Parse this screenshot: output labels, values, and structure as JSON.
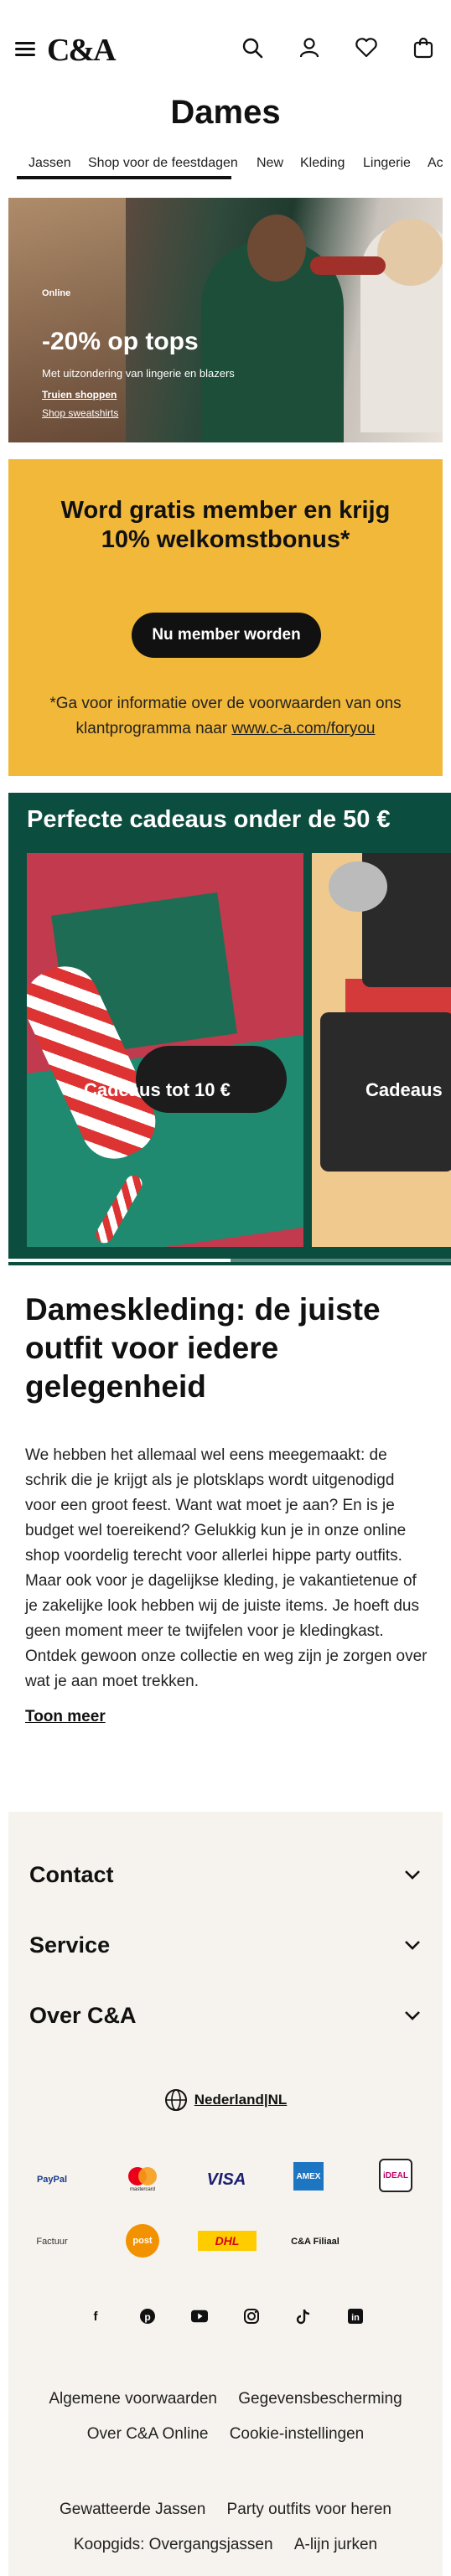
{
  "header": {
    "logo": "C&A",
    "page_title": "Dames"
  },
  "tabs": [
    "Jassen",
    "Shop voor de feestdagen",
    "New",
    "Kleding",
    "Lingerie",
    "Ac"
  ],
  "hero": {
    "eyebrow": "Online",
    "headline": "-20% op tops",
    "subline": "Met uitzondering van lingerie en blazers",
    "link_primary": "Truien shoppen",
    "link_secondary": "Shop sweatshirts"
  },
  "member": {
    "title": "Word gratis member en krijg 10% welkomstbonus*",
    "button": "Nu member worden",
    "note_prefix": "*Ga voor informatie over de voorwaarden van ons klantprogramma naar ",
    "note_link": "www.c-a.com/foryou"
  },
  "gifts": {
    "title": "Perfecte cadeaus onder de 50 €",
    "cards": [
      {
        "label": "Cadeaus tot 10 €"
      },
      {
        "label": "Cadeaus"
      }
    ]
  },
  "seo": {
    "title": "Dameskleding: de juiste outfit voor iedere gelegenheid",
    "body": "We hebben het allemaal wel eens meegemaakt: de schrik die je krijgt als je plotsklaps wordt uitgenodigd voor een groot feest. Want wat moet je aan? En is je budget wel toereikend? Gelukkig kun je in onze online shop voordelig terecht voor allerlei hippe party outfits. Maar ook voor je dagelijkse kleding, je vakantietenue of je zakelijke look hebben wij de juiste items. Je hoeft dus geen moment meer te twijfelen voor je kledingkast. Ontdek gewoon onze collectie en weg zijn je zorgen over wat je aan moet trekken.",
    "more": "Toon meer"
  },
  "footer": {
    "accordions": [
      "Contact",
      "Service",
      "Over C&A"
    ],
    "language": "Nederland|NL",
    "payments_row1": [
      "PayPal",
      "mastercard",
      "VISA",
      "AMEX",
      "iDEAL"
    ],
    "payments_row2": [
      "Factuur",
      "post",
      "DHL",
      "C&A Filiaal"
    ],
    "social": [
      "facebook-icon",
      "pinterest-icon",
      "youtube-icon",
      "instagram-icon",
      "tiktok-icon",
      "linkedin-icon"
    ],
    "links_row1": [
      "Algemene voorwaarden",
      "Gegevensbescherming"
    ],
    "links_row2": [
      "Over C&A Online",
      "Cookie-instellingen"
    ],
    "links_row3": [
      "Gewatteerde Jassen",
      "Party outfits voor heren"
    ],
    "links_row4": [
      "Koopgids: Overgangsjassen",
      "A-lijn jurken"
    ]
  },
  "colors": {
    "member_bg": "#f2b83a",
    "gifts_bg": "#0b4d3e",
    "footer_bg": "#f6f3ee"
  }
}
